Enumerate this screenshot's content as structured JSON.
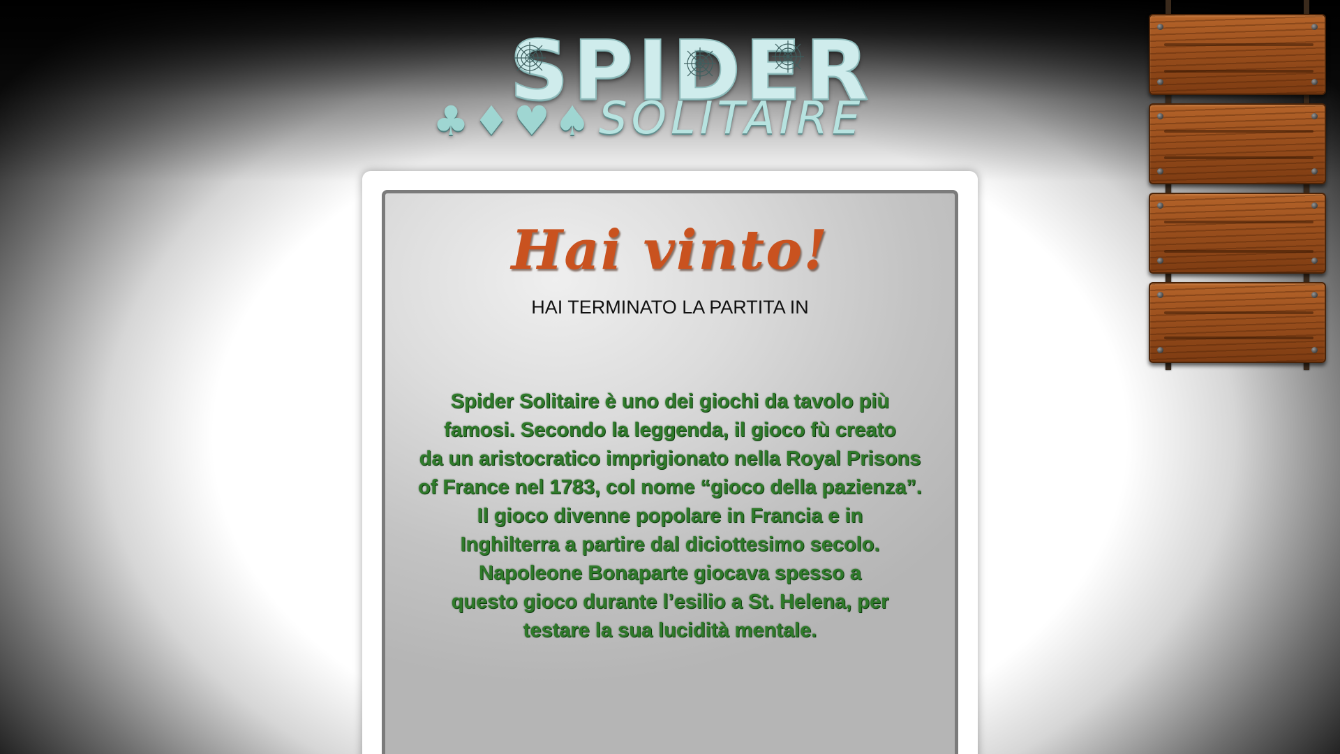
{
  "logo": {
    "title": "SPIDER",
    "subtitle": "SOLITAIRE",
    "suits": [
      {
        "name": "club-icon",
        "glyph": "♣"
      },
      {
        "name": "diamond-icon",
        "glyph": "♦"
      },
      {
        "name": "heart-icon",
        "glyph": "♥"
      },
      {
        "name": "spade-icon",
        "glyph": "♠"
      }
    ]
  },
  "win_panel": {
    "title": "Hai vinto!",
    "finished_label": "HAI TERMINATO LA PARTITA IN",
    "finished_time": "",
    "history_lines": [
      "Spider Solitaire è uno dei giochi da tavolo più",
      "famosi. Secondo la leggenda, il gioco fù creato",
      "da un aristocratico imprigionato nella Royal Prisons",
      "of France nel 1783, col nome “gioco della pazienza”.",
      "Il gioco divenne popolare in Francia e in",
      "Inghilterra a partire dal diciottesimo secolo.",
      "Napoleone Bonaparte giocava spesso a",
      "questo gioco durante l’esilio a St. Helena, per",
      "testare la sua lucidità mentale."
    ]
  },
  "side_menu": {
    "planks": [
      {
        "label": ""
      },
      {
        "label": ""
      },
      {
        "label": ""
      },
      {
        "label": ""
      }
    ]
  },
  "colors": {
    "title_orange": "#c9521f",
    "history_green": "#2f7a2a",
    "logo_teal": "#cfecec",
    "wood": "#9a4f1d"
  }
}
